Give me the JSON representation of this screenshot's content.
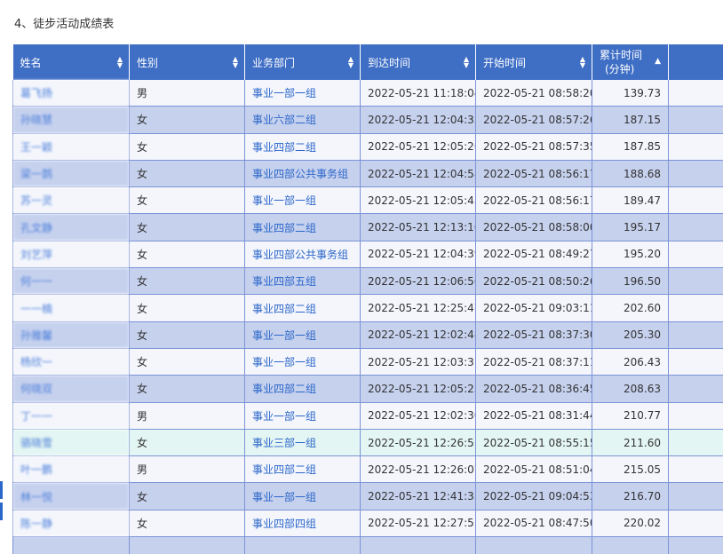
{
  "page_title": "4、徒步活动成绩表",
  "table": {
    "headers": {
      "name": "姓名",
      "gender": "性别",
      "dept": "业务部门",
      "arrive": "到达时间",
      "start": "开始时间",
      "total_line1": "累计时间",
      "total_line2": "(分钟)"
    },
    "sort_icons": {
      "unsorted": "sort-both-icon",
      "ascending": "sort-up-icon"
    },
    "rows": [
      {
        "name": "葛飞扬",
        "gender": "男",
        "dept": "事业一部一组",
        "arrive": "2022-05-21 11:18:04",
        "start": "2022-05-21 08:58:20",
        "total": "139.73"
      },
      {
        "name": "孙晓慧",
        "gender": "女",
        "dept": "事业六部二组",
        "arrive": "2022-05-21 12:04:35",
        "start": "2022-05-21 08:57:26",
        "total": "187.15"
      },
      {
        "name": "王一颖",
        "gender": "女",
        "dept": "事业四部二组",
        "arrive": "2022-05-21 12:05:26",
        "start": "2022-05-21 08:57:35",
        "total": "187.85"
      },
      {
        "name": "梁一鹊",
        "gender": "女",
        "dept": "事业四部公共事务组",
        "arrive": "2022-05-21 12:04:58",
        "start": "2022-05-21 08:56:17",
        "total": "188.68"
      },
      {
        "name": "苏一灵",
        "gender": "女",
        "dept": "事业一部一组",
        "arrive": "2022-05-21 12:05:45",
        "start": "2022-05-21 08:56:17",
        "total": "189.47"
      },
      {
        "name": "孔文静",
        "gender": "女",
        "dept": "事业四部二组",
        "arrive": "2022-05-21 12:13:10",
        "start": "2022-05-21 08:58:00",
        "total": "195.17"
      },
      {
        "name": "刘艺萍",
        "gender": "女",
        "dept": "事业四部公共事务组",
        "arrive": "2022-05-21 12:04:39",
        "start": "2022-05-21 08:49:27",
        "total": "195.20"
      },
      {
        "name": "何一一",
        "gender": "女",
        "dept": "事业四部五组",
        "arrive": "2022-05-21 12:06:56",
        "start": "2022-05-21 08:50:26",
        "total": "196.50"
      },
      {
        "name": "一一楠",
        "gender": "女",
        "dept": "事业四部二组",
        "arrive": "2022-05-21 12:25:47",
        "start": "2022-05-21 09:03:11",
        "total": "202.60"
      },
      {
        "name": "孙雅馨",
        "gender": "女",
        "dept": "事业一部一组",
        "arrive": "2022-05-21 12:02:48",
        "start": "2022-05-21 08:37:30",
        "total": "205.30"
      },
      {
        "name": "杨欣一",
        "gender": "女",
        "dept": "事业一部一组",
        "arrive": "2022-05-21 12:03:37",
        "start": "2022-05-21 08:37:11",
        "total": "206.43"
      },
      {
        "name": "何晓双",
        "gender": "女",
        "dept": "事业四部二组",
        "arrive": "2022-05-21 12:05:23",
        "start": "2022-05-21 08:36:45",
        "total": "208.63"
      },
      {
        "name": "丁一一",
        "gender": "男",
        "dept": "事业一部一组",
        "arrive": "2022-05-21 12:02:30",
        "start": "2022-05-21 08:31:44",
        "total": "210.77"
      },
      {
        "name": "骆晓雪",
        "gender": "女",
        "dept": "事业三部一组",
        "arrive": "2022-05-21 12:26:51",
        "start": "2022-05-21 08:55:15",
        "total": "211.60"
      },
      {
        "name": "叶一鹏",
        "gender": "男",
        "dept": "事业四部二组",
        "arrive": "2022-05-21 12:26:07",
        "start": "2022-05-21 08:51:04",
        "total": "215.05"
      },
      {
        "name": "林一悦",
        "gender": "女",
        "dept": "事业一部一组",
        "arrive": "2022-05-21 12:41:35",
        "start": "2022-05-21 09:04:53",
        "total": "216.70"
      },
      {
        "name": "陈一静",
        "gender": "女",
        "dept": "事业四部四组",
        "arrive": "2022-05-21 12:27:51",
        "start": "2022-05-21 08:47:50",
        "total": "220.02"
      }
    ],
    "highlighted_row_index": 13
  }
}
